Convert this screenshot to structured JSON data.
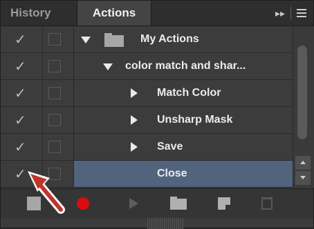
{
  "tabs": [
    {
      "label": "History"
    },
    {
      "label": "Actions"
    }
  ],
  "tab_icons": {
    "expand": "double-chevron-right-icon",
    "menu": "panel-menu-icon"
  },
  "rows": [
    {
      "label": "My Actions",
      "kind": "set",
      "expanded": true,
      "checked": true,
      "selected": false
    },
    {
      "label": "color match and shar...",
      "kind": "action",
      "expanded": true,
      "checked": true,
      "selected": false
    },
    {
      "label": "Match Color",
      "kind": "step",
      "expanded": false,
      "checked": true,
      "selected": false
    },
    {
      "label": "Unsharp Mask",
      "kind": "step",
      "expanded": false,
      "checked": true,
      "selected": false
    },
    {
      "label": "Save",
      "kind": "step",
      "expanded": false,
      "checked": true,
      "selected": false
    },
    {
      "label": "Close",
      "kind": "step",
      "expanded": false,
      "checked": true,
      "selected": true
    }
  ],
  "bottom_toolbar": [
    {
      "icon": "stop-icon"
    },
    {
      "icon": "record-icon"
    },
    {
      "icon": "play-icon"
    },
    {
      "icon": "new-set-folder-icon"
    },
    {
      "icon": "new-action-icon"
    },
    {
      "icon": "delete-trash-icon"
    }
  ],
  "colors": {
    "selection": "#52647d",
    "record": "#d80d0d",
    "annotation_arrow": "#c0352b"
  }
}
